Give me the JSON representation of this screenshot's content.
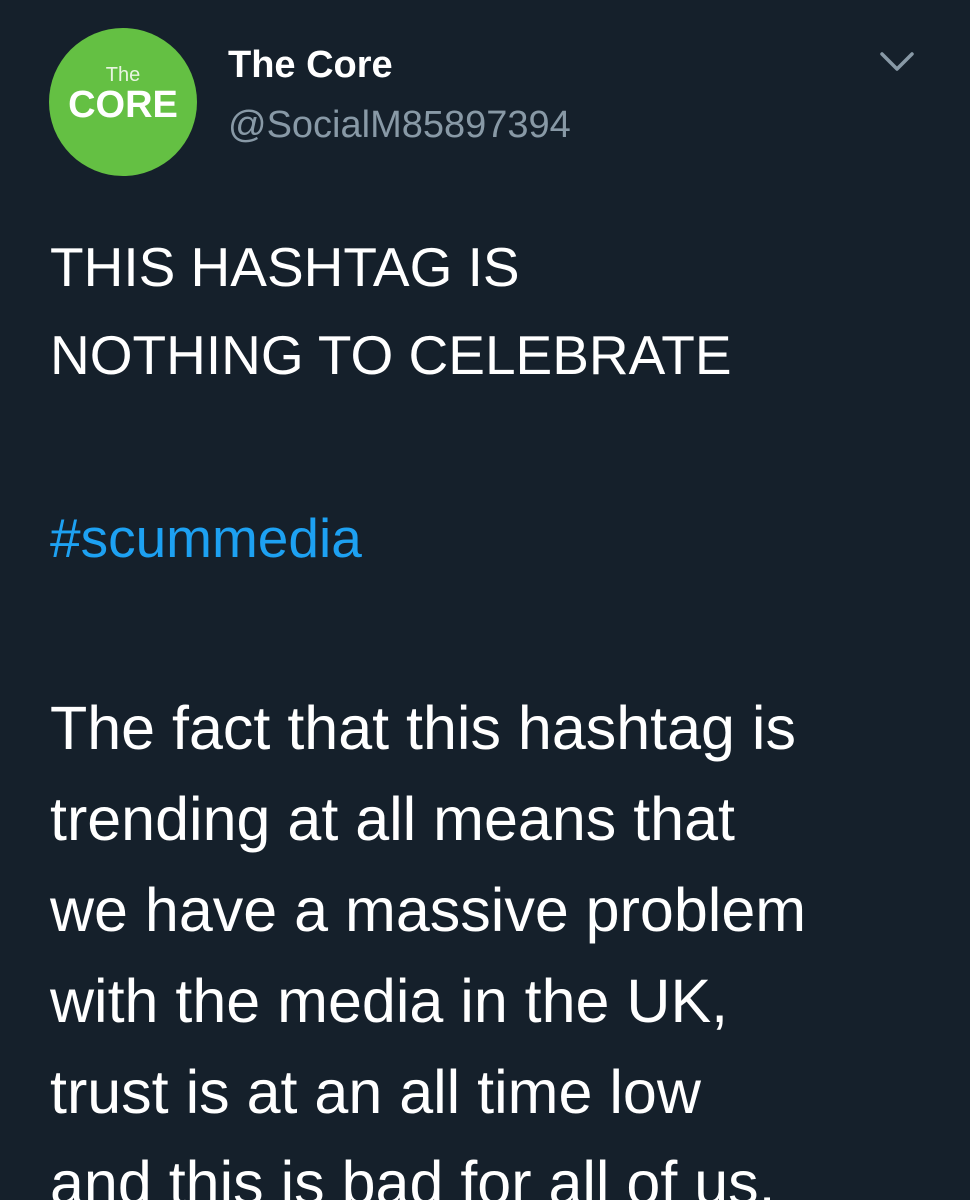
{
  "tweet": {
    "avatar": {
      "line1": "The",
      "line2": "CORE",
      "color": "#64c043"
    },
    "display_name": "The Core",
    "handle": "@SocialM85897394",
    "menu_icon": "chevron-down-icon",
    "headline_lines": [
      "THIS HASHTAG IS",
      "NOTHING TO CELEBRATE"
    ],
    "hashtag": "#scummedia",
    "body_lines": [
      "The fact that this hashtag is",
      "trending at all means that",
      "we have a massive problem",
      "with the media in the UK,",
      "trust is at an all time low",
      "and this is bad for all of us."
    ]
  },
  "colors": {
    "background": "#15202b",
    "text": "#ffffff",
    "secondary_text": "#8899a6",
    "link": "#1da1f2"
  }
}
